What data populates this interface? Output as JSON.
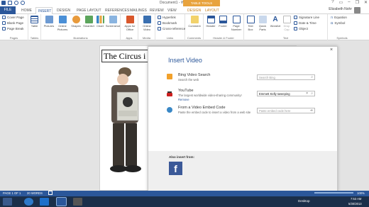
{
  "window": {
    "title": "Document1 - Word",
    "context_group": "TABLE TOOLS"
  },
  "tabs": [
    "FILE",
    "HOME",
    "INSERT",
    "DESIGN",
    "PAGE LAYOUT",
    "REFERENCES",
    "MAILINGS",
    "REVIEW",
    "VIEW",
    "DESIGN",
    "LAYOUT"
  ],
  "user": "Elizabeth Nohr",
  "ribbon": {
    "pages": {
      "items": [
        "Cover Page",
        "Blank Page",
        "Page Break"
      ],
      "label": "Pages"
    },
    "tables": {
      "button": "Table",
      "label": "Tables"
    },
    "illustrations": {
      "buttons": [
        "Pictures",
        "Online Pictures",
        "Shapes",
        "SmartArt",
        "Chart",
        "Screenshot"
      ],
      "label": "Illustrations"
    },
    "apps": {
      "button": "Apps for Office",
      "label": "Apps"
    },
    "media": {
      "button": "Online Video",
      "label": "Media"
    },
    "links": {
      "items": [
        "Hyperlink",
        "Bookmark",
        "Cross-reference"
      ],
      "label": "Links"
    },
    "comments": {
      "button": "Comment",
      "label": "Comments"
    },
    "header_footer": {
      "buttons": [
        "Header",
        "Footer",
        "Page Number"
      ],
      "label": "Header & Footer"
    },
    "text": {
      "buttons": [
        "Text Box",
        "Quick Parts",
        "WordArt",
        "Drop Cap"
      ],
      "items": [
        "Signature Line",
        "Date & Time",
        "Object"
      ],
      "label": "Text"
    },
    "symbols": {
      "items": [
        "Equation",
        "Symbol"
      ],
      "label": "Symbols"
    }
  },
  "document": {
    "heading": "The Circus i"
  },
  "dialog": {
    "title": "Insert Video",
    "close": "×",
    "rows": [
      {
        "title": "Bing Video Search",
        "sub": "Search the web",
        "input": "Search Bing",
        "filled": false,
        "link": ""
      },
      {
        "title": "YouTube",
        "sub": "The largest worldwide video-sharing community!",
        "input": "Emmett Kelly sweeping",
        "filled": true,
        "link": "Remove"
      },
      {
        "title": "From a Video Embed Code",
        "sub": "Paste the embed code to insert a video from a web site",
        "input": "Paste embed code here",
        "filled": false,
        "link": ""
      }
    ],
    "also_insert": "Also insert from:",
    "facebook": "f"
  },
  "status": {
    "page": "PAGE 1 OF 1",
    "words": "20 WORDS",
    "zoom": "100%"
  },
  "taskbar": {
    "lang": "Desktop",
    "time": "7:53 AM",
    "date": "5/30/2013"
  },
  "colors": {
    "accent": "#2b579a",
    "context": "#e8a33d",
    "facebook": "#3b5998"
  }
}
